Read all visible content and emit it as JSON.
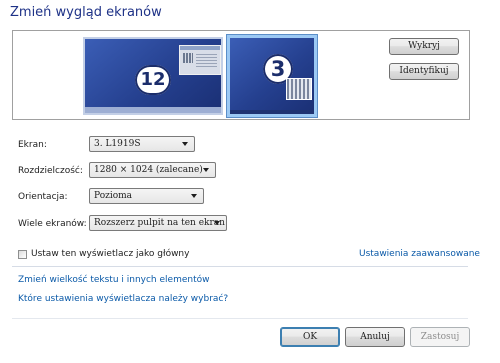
{
  "title": "Zmień wygląd ekranów",
  "monitors": {
    "main_number": "12",
    "selected_number": "3"
  },
  "buttons": {
    "detect": "Wykryj",
    "identify": "Identyfikuj",
    "ok": "OK",
    "cancel": "Anuluj",
    "apply": "Zastosuj"
  },
  "fields": [
    {
      "label": "Ekran:",
      "value": "3. L1919S"
    },
    {
      "label": "Rozdzielczość:",
      "value": "1280 × 1024 (zalecane)"
    },
    {
      "label": "Orientacja:",
      "value": "Pozioma"
    },
    {
      "label": "Wiele ekranów:",
      "value": "Rozszerz pulpit na ten ekran"
    }
  ],
  "checkbox": {
    "label": "Ustaw ten wyświetlacz jako główny",
    "checked": false
  },
  "links": {
    "advanced": "Ustawienia zaawansowane",
    "text_size": "Zmień wielkość tekstu i innych elementów",
    "which_settings": "Które ustawienia wyświetlacza należy wybrać?"
  },
  "colors": {
    "title": "#1e3287",
    "link": "#0b5aa8",
    "monitor_fill": "#25408f",
    "selected_border": "#9cc9f4"
  },
  "icons": [
    "monitor-icon",
    "dropdown-arrow-icon",
    "checkbox-icon"
  ]
}
